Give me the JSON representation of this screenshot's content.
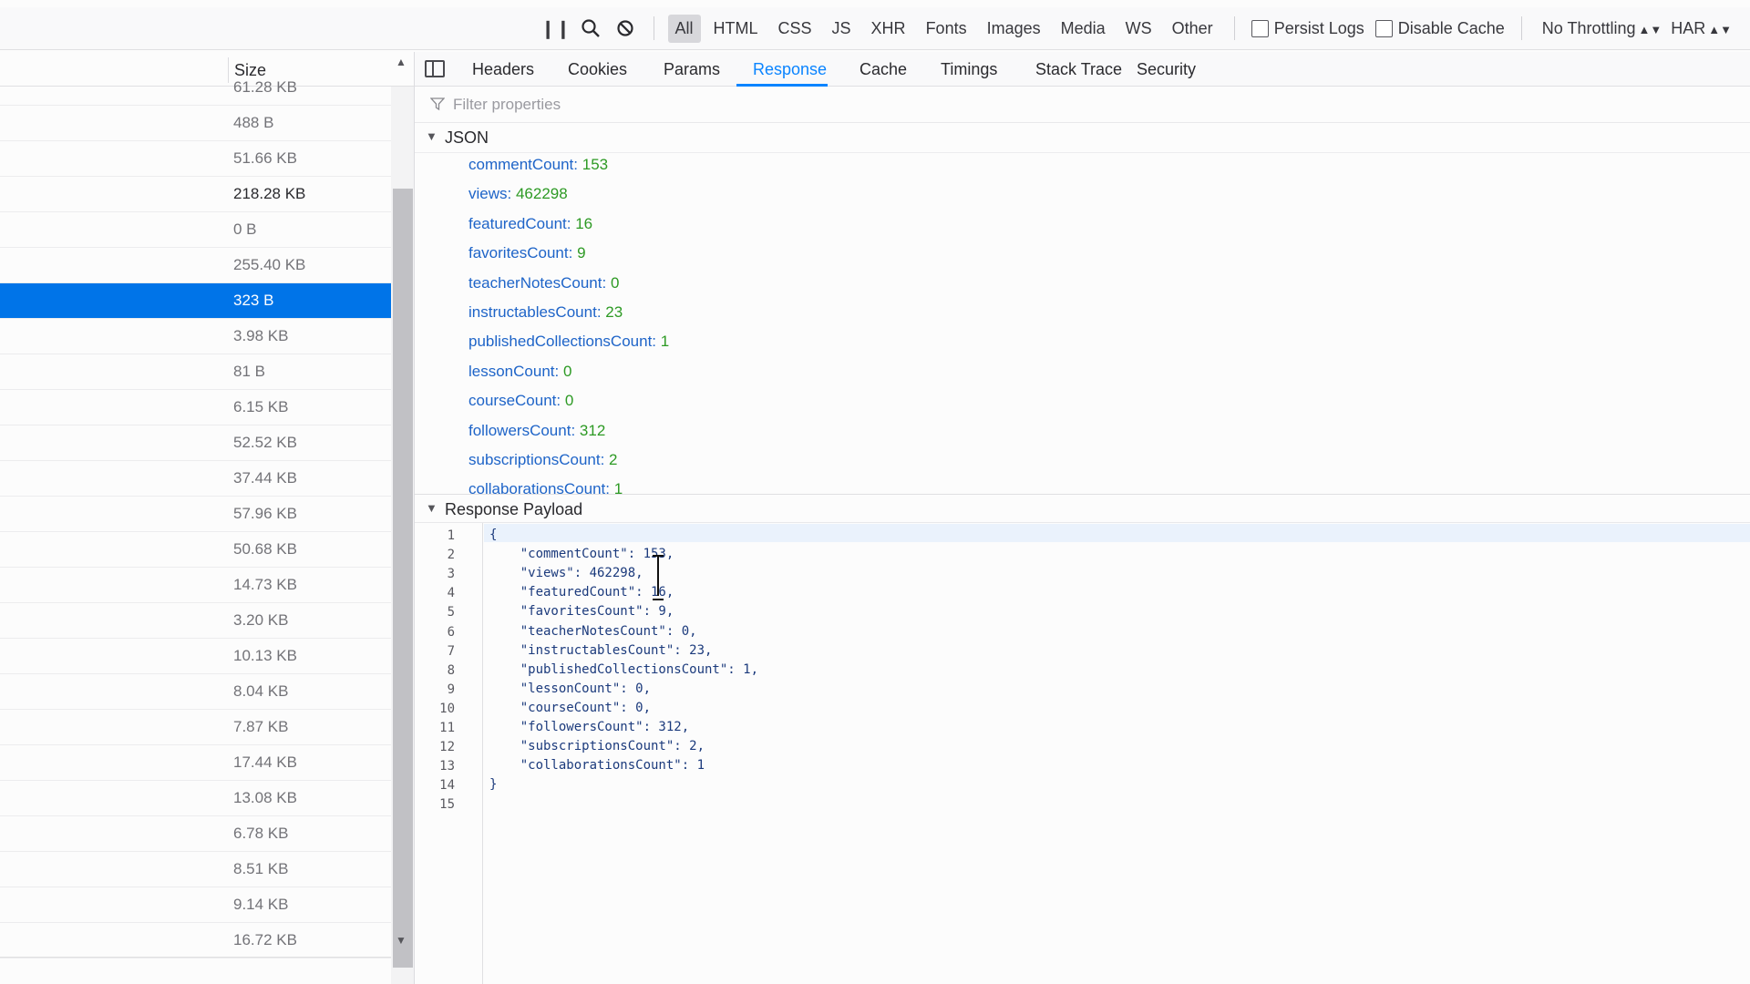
{
  "toolbar": {
    "filters": [
      {
        "label": "All",
        "active": true
      },
      {
        "label": "HTML",
        "active": false
      },
      {
        "label": "CSS",
        "active": false
      },
      {
        "label": "JS",
        "active": false
      },
      {
        "label": "XHR",
        "active": false
      },
      {
        "label": "Fonts",
        "active": false
      },
      {
        "label": "Images",
        "active": false
      },
      {
        "label": "Media",
        "active": false
      },
      {
        "label": "WS",
        "active": false
      },
      {
        "label": "Other",
        "active": false
      }
    ],
    "persist_logs": "Persist Logs",
    "disable_cache": "Disable Cache",
    "throttling": "No Throttling",
    "har": "HAR"
  },
  "requests": {
    "size_header": "Size",
    "sizes": [
      "61.28 KB",
      "488 B",
      "51.66 KB",
      "218.28 KB",
      "0 B",
      "255.40 KB",
      "323 B",
      "3.98 KB",
      "81 B",
      "6.15 KB",
      "52.52 KB",
      "37.44 KB",
      "57.96 KB",
      "50.68 KB",
      "14.73 KB",
      "3.20 KB",
      "10.13 KB",
      "8.04 KB",
      "7.87 KB",
      "17.44 KB",
      "13.08 KB",
      "6.78 KB",
      "8.51 KB",
      "9.14 KB",
      "16.72 KB"
    ],
    "selected_index": 6
  },
  "details": {
    "tabs": [
      "Headers",
      "Cookies",
      "Params",
      "Response",
      "Cache",
      "Timings",
      "Stack Trace",
      "Security"
    ],
    "active_tab": "Response",
    "filter_placeholder": "Filter properties",
    "json_section": "JSON",
    "properties": [
      {
        "key": "commentCount",
        "value": "153"
      },
      {
        "key": "views",
        "value": "462298"
      },
      {
        "key": "featuredCount",
        "value": "16"
      },
      {
        "key": "favoritesCount",
        "value": "9"
      },
      {
        "key": "teacherNotesCount",
        "value": "0"
      },
      {
        "key": "instructablesCount",
        "value": "23"
      },
      {
        "key": "publishedCollectionsCount",
        "value": "1"
      },
      {
        "key": "lessonCount",
        "value": "0"
      },
      {
        "key": "courseCount",
        "value": "0"
      },
      {
        "key": "followersCount",
        "value": "312"
      },
      {
        "key": "subscriptionsCount",
        "value": "2"
      },
      {
        "key": "collaborationsCount",
        "value": "1"
      }
    ],
    "payload_section": "Response Payload",
    "payload_lines": [
      "{",
      "    \"commentCount\": 153,",
      "    \"views\": 462298,",
      "    \"featuredCount\": 16,",
      "    \"favoritesCount\": 9,",
      "    \"teacherNotesCount\": 0,",
      "    \"instructablesCount\": 23,",
      "    \"publishedCollectionsCount\": 1,",
      "    \"lessonCount\": 0,",
      "    \"courseCount\": 0,",
      "    \"followersCount\": 312,",
      "    \"subscriptionsCount\": 2,",
      "    \"collaborationsCount\": 1",
      "}",
      ""
    ]
  }
}
